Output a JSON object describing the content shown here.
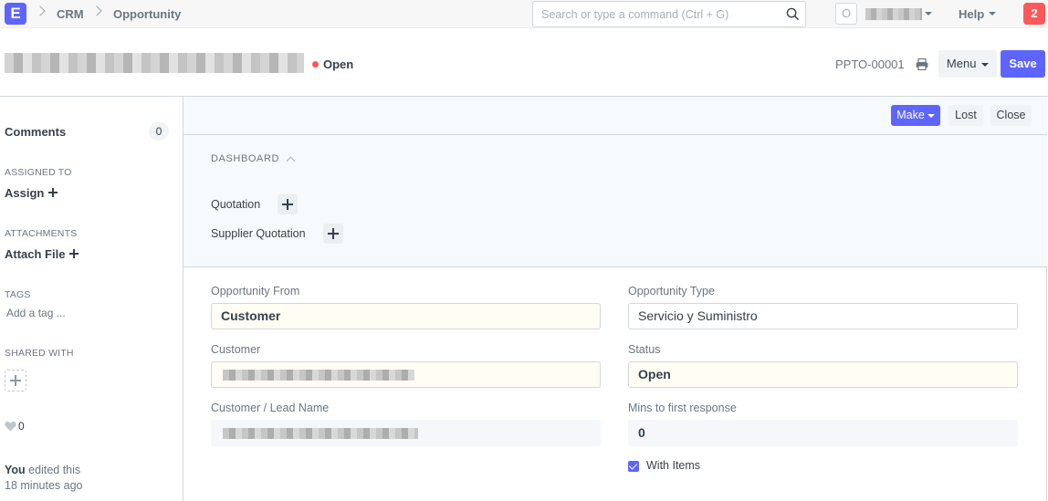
{
  "navbar": {
    "logo_letter": "E",
    "breadcrumbs": [
      "CRM",
      "Opportunity"
    ],
    "search_placeholder": "Search or type a command (Ctrl + G)",
    "avatar_letter": "O",
    "help_label": "Help",
    "notification_count": "2"
  },
  "page_head": {
    "status": "Open",
    "doc_name": "PPTO-00001",
    "menu_label": "Menu",
    "save_label": "Save"
  },
  "sidebar": {
    "comments_label": "Comments",
    "comments_count": "0",
    "assigned_heading": "ASSIGNED TO",
    "assign_label": "Assign",
    "attachments_heading": "ATTACHMENTS",
    "attach_label": "Attach File",
    "tags_heading": "TAGS",
    "add_tag_label": "Add a tag ...",
    "shared_heading": "SHARED WITH",
    "like_count": "0",
    "timeline_user": "You",
    "timeline_action": "edited this",
    "timeline_time": "18 minutes ago"
  },
  "toolbar": {
    "make_label": "Make",
    "lost_label": "Lost",
    "close_label": "Close"
  },
  "dashboard": {
    "title": "DASHBOARD",
    "links": [
      "Quotation",
      "Supplier Quotation"
    ]
  },
  "form": {
    "opportunity_from": {
      "label": "Opportunity From",
      "value": "Customer"
    },
    "opportunity_type": {
      "label": "Opportunity Type",
      "value": "Servicio y Suministro"
    },
    "customer": {
      "label": "Customer"
    },
    "status": {
      "label": "Status",
      "value": "Open"
    },
    "customer_lead_name": {
      "label": "Customer / Lead Name"
    },
    "mins_first_response": {
      "label": "Mins to first response",
      "value": "0"
    },
    "with_items": {
      "label": "With Items",
      "checked": true
    }
  },
  "colors": {
    "primary": "#5e64ff",
    "danger": "#ff5858",
    "select_bg": "#fffdf4"
  }
}
